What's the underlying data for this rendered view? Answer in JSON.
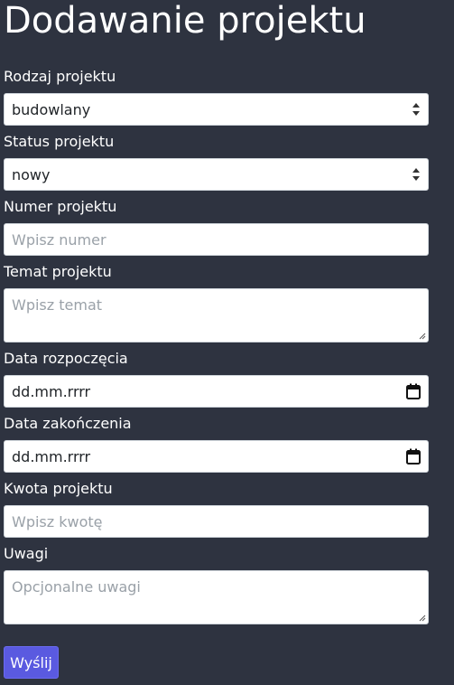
{
  "page": {
    "title": "Dodawanie projektu"
  },
  "form": {
    "project_type": {
      "label": "Rodzaj projektu",
      "value": "budowlany"
    },
    "project_status": {
      "label": "Status projektu",
      "value": "nowy"
    },
    "project_number": {
      "label": "Numer projektu",
      "placeholder": "Wpisz numer"
    },
    "project_topic": {
      "label": "Temat projektu",
      "placeholder": "Wpisz temat"
    },
    "start_date": {
      "label": "Data rozpoczęcia",
      "value": "dd.mm.rrrr"
    },
    "end_date": {
      "label": "Data zakończenia",
      "value": "dd.mm.rrrr"
    },
    "project_amount": {
      "label": "Kwota projektu",
      "placeholder": "Wpisz kwotę"
    },
    "notes": {
      "label": "Uwagi",
      "placeholder": "Opcjonalne uwagi"
    },
    "submit_label": "Wyślij"
  },
  "icons": {
    "select_arrow": "select-arrows-icon",
    "calendar": "calendar-icon",
    "resize": "resize-handle-icon"
  },
  "colors": {
    "background": "#2e3340",
    "button": "#5a5ae0",
    "text": "#ffffff",
    "placeholder": "#9aa1a8"
  }
}
